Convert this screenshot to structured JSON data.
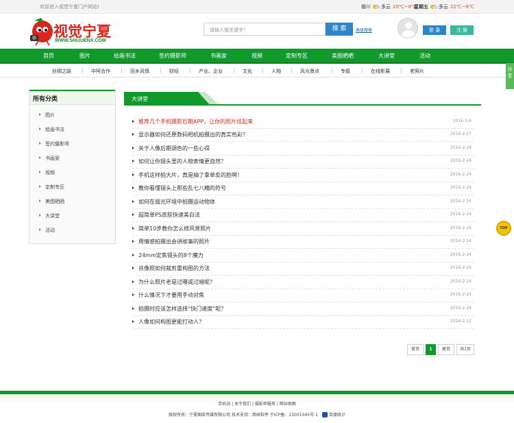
{
  "topbar": {
    "welcome": "欢迎进入视觉宁夏门户网站!",
    "weather": [
      {
        "city": "银川",
        "cond": "多云",
        "temp": "20℃~8℃"
      },
      {
        "city": "星期五",
        "cond": "多云",
        "temp": "22℃~8℃"
      }
    ]
  },
  "header": {
    "logo_text": "视觉宁夏",
    "logo_url": "WWW.SHIJUENX.COM",
    "search_placeholder": "请输入搜关键字！",
    "search_button": "搜 索",
    "advanced_search": "高级搜索",
    "login": "登 录",
    "register": "注 册"
  },
  "nav": [
    "首页",
    "图片",
    "绘画书法",
    "签约摄影师",
    "书画家",
    "视频",
    "定制专区",
    "美图晒晒",
    "大讲堂",
    "活动"
  ],
  "subnav": [
    "丝绸之路",
    "中阿合作",
    "回乡风情",
    "财经",
    "产业、企业",
    "文化",
    "人物",
    "风光景点",
    "专题",
    "在线影展",
    "老照片"
  ],
  "sidebar": {
    "title": "所有分类",
    "items": [
      "图片",
      "绘画书法",
      "签约摄影师",
      "书画家",
      "视频",
      "定制专区",
      "美图晒晒",
      "大讲堂",
      "活动"
    ]
  },
  "content": {
    "tab": "大讲堂",
    "articles": [
      {
        "title": "推荐几个手机摄影后期APP，让你的照片炫起来",
        "date": "2016-3-6",
        "hot": true
      },
      {
        "title": "显示器如何还原数码相机拍摄出的真实色彩？",
        "date": "2016-2-27"
      },
      {
        "title": "关于人像后期调色的一些心得",
        "date": "2016-2-24"
      },
      {
        "title": "如何让你镜头里的人物表情更自然？",
        "date": "2016-2-24"
      },
      {
        "title": "手机这样拍大片，真是抽了拿单反的脸啊！",
        "date": "2016-2-24"
      },
      {
        "title": "教你看懂镜头上那些乱七八糟的符号",
        "date": "2016-2-24"
      },
      {
        "title": "如何在弱光环境中拍摄运动物体",
        "date": "2016-2-24"
      },
      {
        "title": "超简单PS皮肤快速美白法",
        "date": "2016-2-24"
      },
      {
        "title": "简单10步教你怎么修风景照片",
        "date": "2016-2-24"
      },
      {
        "title": "用情感拍摄出会讲故事的照片",
        "date": "2016-2-24"
      },
      {
        "title": "24mm定焦镜头的8个魔力",
        "date": "2016-2-24"
      },
      {
        "title": "肖像照如何裁剪重构图的方法",
        "date": "2016-2-24"
      },
      {
        "title": "为什么照片老是过曝或过暗呢？",
        "date": "2016-2-24"
      },
      {
        "title": "什么情况下才要用手动对焦",
        "date": "2016-2-24"
      },
      {
        "title": "拍摄时应该怎样选择“快门速度”呢？",
        "date": "2016-2-24"
      },
      {
        "title": "人像如何构图更能打动人？",
        "date": "2016-2-22"
      }
    ]
  },
  "pager": {
    "first": "首页",
    "current": "1",
    "last": "尾页",
    "total": "共1页"
  },
  "footer": {
    "links": [
      "手机站",
      "关于我们",
      "摄影师服务",
      "网站地图"
    ],
    "copyright": "版权所有：宁夏图库传媒有限公司  技术支持：西岐软件  宁ICP备：15001045号-1",
    "stat": "百度统计"
  },
  "float": {
    "share": "分享",
    "top": "TOP"
  },
  "colors": {
    "brand_green": "#119a2c",
    "accent_red": "#d8261c",
    "button_blue": "#2e86c8"
  }
}
